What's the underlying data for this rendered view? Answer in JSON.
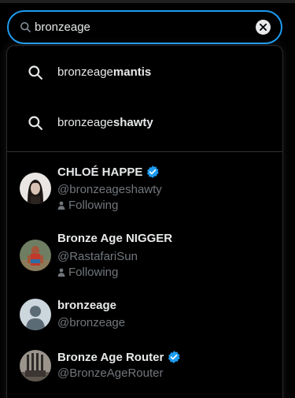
{
  "search": {
    "value": "bronzeage",
    "icon": "search-icon",
    "clear_icon": "close-icon"
  },
  "suggestions": [
    {
      "prefix": "bronzeage",
      "suffix": "mantis"
    },
    {
      "prefix": "bronzeage",
      "suffix": "shawty"
    }
  ],
  "users": [
    {
      "name": "CHLOÉ HAPPE",
      "handle": "@bronzeageshawty",
      "verified": true,
      "following": "Following"
    },
    {
      "name": "Bronze Age NIGGER",
      "handle": "@RastafariSun",
      "verified": false,
      "following": "Following"
    },
    {
      "name": "bronzeage",
      "handle": "@bronzeage",
      "verified": false,
      "following": ""
    },
    {
      "name": "Bronze Age Router",
      "handle": "@BronzeAgeRouter",
      "verified": true,
      "following": ""
    }
  ],
  "colors": {
    "accent": "#1d9bf0",
    "muted": "#71767b",
    "text": "#e7e9ea",
    "background": "#000000"
  }
}
